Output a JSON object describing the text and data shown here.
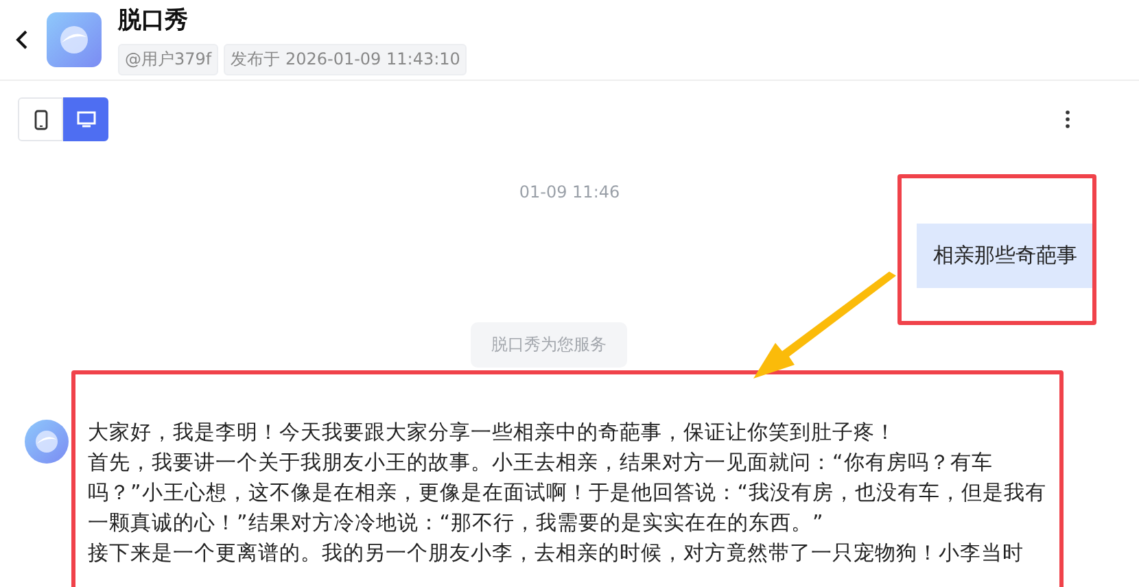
{
  "header": {
    "title": "脱口秀",
    "tags": [
      "@用户379f",
      "发布于 2026-01-09 11:43:10"
    ]
  },
  "view_toggle": [
    {
      "kind": "phone",
      "selected": false
    },
    {
      "kind": "desktop",
      "selected": true
    }
  ],
  "chat": {
    "timestamp": "01-09 11:46",
    "user_message": "相亲那些奇葩事",
    "system_notice": "脱口秀为您服务",
    "bot_paragraphs": [
      "大家好，我是李明！今天我要跟大家分享一些相亲中的奇葩事，保证让你笑到肚子疼！",
      "首先，我要讲一个关于我朋友小王的故事。小王去相亲，结果对方一见面就问：“你有房吗？有车吗？”小王心想，这不像是在相亲，更像是在面试啊！于是他回答说：“我没有房，也没有车，但是我有一颗真诚的心！”结果对方冷冷地说：“那不行，我需要的是实实在在的东西。”",
      "接下来是一个更离谱的。我的另一个朋友小李，去相亲的时候，对方竟然带了一只宠物狗！小李当时"
    ]
  }
}
